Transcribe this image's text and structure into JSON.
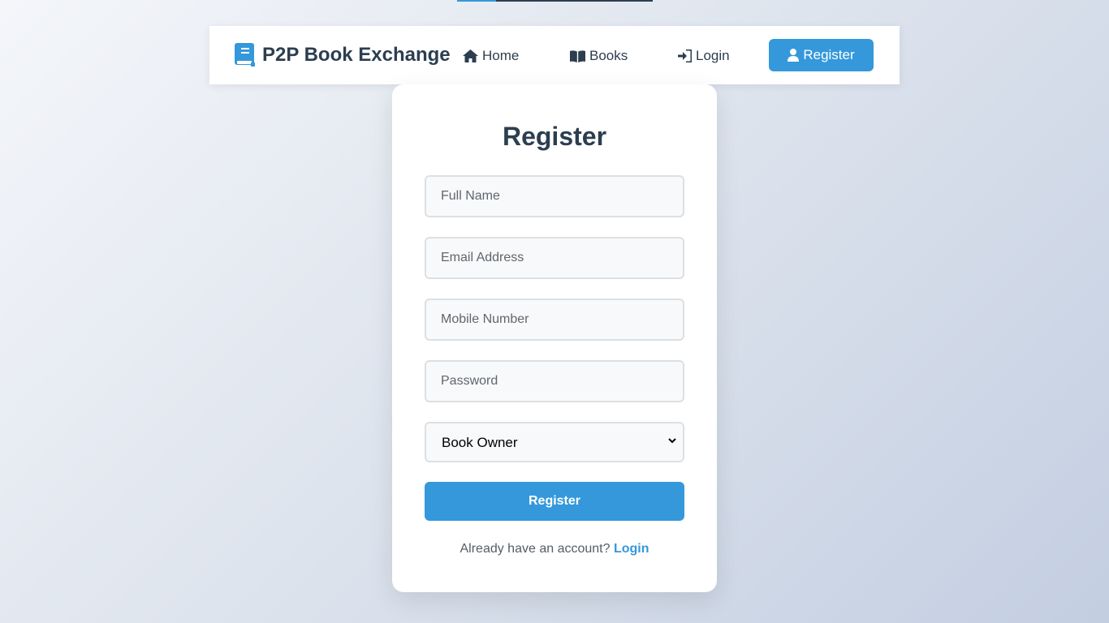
{
  "progress": {
    "fraction": 0.2
  },
  "navbar": {
    "brand": {
      "icon": "book-icon",
      "text": "P2P Book Exchange"
    },
    "links": {
      "home": {
        "icon": "home-icon",
        "label": "Home"
      },
      "books": {
        "icon": "open-book-icon",
        "label": "Books"
      },
      "login": {
        "icon": "sign-in-icon",
        "label": "Login"
      },
      "register": {
        "icon": "user-icon",
        "label": "Register"
      }
    }
  },
  "form": {
    "title": "Register",
    "full_name": {
      "placeholder": "Full Name",
      "value": ""
    },
    "email": {
      "placeholder": "Email Address",
      "value": ""
    },
    "mobile": {
      "placeholder": "Mobile Number",
      "value": ""
    },
    "password": {
      "placeholder": "Password",
      "value": ""
    },
    "role": {
      "selected": "Book Owner",
      "icon": "chevron-down-icon"
    },
    "submit_label": "Register",
    "footer": {
      "text": "Already have an account?",
      "link": "Login"
    }
  },
  "colors": {
    "accent": "#3498db",
    "heading": "#2c3e50",
    "card_bg": "#ffffff"
  }
}
